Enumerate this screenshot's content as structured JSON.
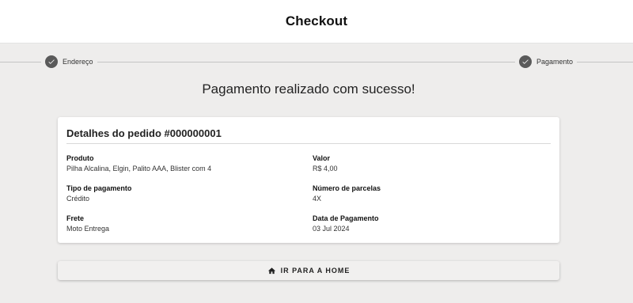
{
  "header": {
    "title": "Checkout"
  },
  "stepper": {
    "steps": [
      {
        "label": "Endereço",
        "icon": "check-icon",
        "status": "completed"
      },
      {
        "label": "Pagamento",
        "icon": "check-icon",
        "status": "completed"
      }
    ]
  },
  "main": {
    "success_message": "Pagamento realizado com sucesso!"
  },
  "order": {
    "title": "Detalhes do pedido #000000001",
    "fields": {
      "product": {
        "label": "Produto",
        "value": "Pilha Alcalina, Elgin, Palito AAA, Blister com 4"
      },
      "value": {
        "label": "Valor",
        "value": "R$ 4,00"
      },
      "payment_type": {
        "label": "Tipo de pagamento",
        "value": "Crédito"
      },
      "installments": {
        "label": "Número de parcelas",
        "value": "4X"
      },
      "shipping": {
        "label": "Frete",
        "value": "Moto Entrega"
      },
      "payment_date": {
        "label": "Data de Pagamento",
        "value": "03 Jul 2024"
      }
    }
  },
  "actions": {
    "home_button_label": "IR PARA A HOME",
    "home_icon": "home-icon"
  },
  "colors": {
    "background": "#eeedec",
    "card": "#ffffff",
    "step_circle": "#5a5a5a"
  }
}
